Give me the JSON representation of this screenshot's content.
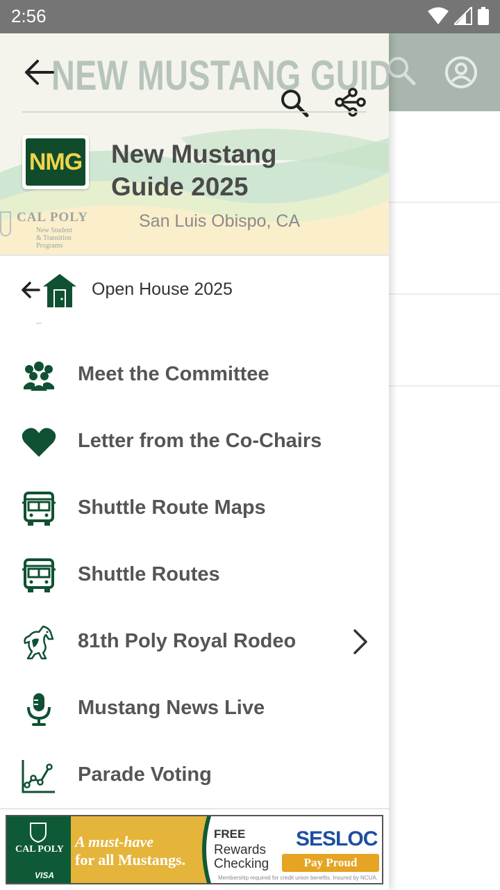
{
  "status_bar": {
    "time": "2:56",
    "icons": [
      "wifi-icon",
      "cell-signal-icon",
      "battery-icon"
    ]
  },
  "background_app": {
    "toolbar_icons": [
      "search-icon",
      "account-circle-icon"
    ]
  },
  "drawer": {
    "header": {
      "watermark": "NEW MUSTANG GUIDE",
      "app_title": "New Mustang Guide 2025",
      "location": "San Luis Obispo, CA",
      "logo_text": "NMG",
      "calpoly_name": "CAL POLY",
      "calpoly_sub_1": "New Student",
      "calpoly_sub_2": "& Transition Programs"
    },
    "toolbar": {
      "back_icon": "arrow-back-icon",
      "search_icon": "search-icon",
      "share_icon": "share-icon"
    },
    "parent": {
      "label": "Open House 2025",
      "icon": "house-icon"
    },
    "items": [
      {
        "label": "Meet the Committee",
        "icon": "group-icon"
      },
      {
        "label": "Letter from the Co-Chairs",
        "icon": "heart-icon"
      },
      {
        "label": "Shuttle Route Maps",
        "icon": "bus-icon"
      },
      {
        "label": "Shuttle Routes",
        "icon": "bus-icon"
      },
      {
        "label": "81th Poly Royal Rodeo",
        "icon": "mustang-icon",
        "has_children": true
      },
      {
        "label": "Mustang News Live",
        "icon": "microphone-icon"
      },
      {
        "label": "Parade Voting",
        "icon": "line-chart-icon"
      }
    ]
  },
  "ad": {
    "brand_left": "CAL POLY",
    "card": "VISA",
    "headline_1": "A must-have",
    "headline_2": "for all Mustangs.",
    "free": "FREE",
    "rewards": "Rewards",
    "checking": "Checking",
    "bank": "SESLOC",
    "cta": "Pay Proud",
    "fine_print": "Membership required for credit union benefits. Insured by NCUA."
  },
  "colors": {
    "accent_green": "#0f5132",
    "status_bar": "#757575",
    "bg_toolbar": "#a8b6ae"
  }
}
